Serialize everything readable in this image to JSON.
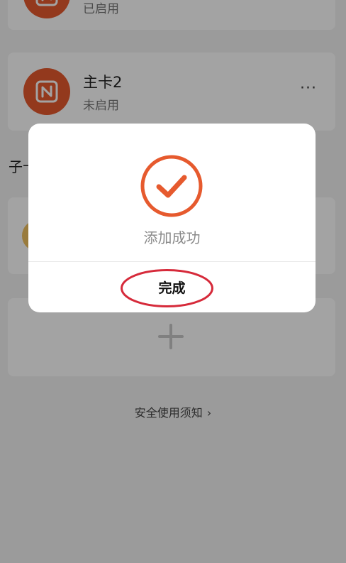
{
  "cards": {
    "top": {
      "status": "已启用"
    },
    "main": {
      "name": "主卡2",
      "status": "未启用",
      "more": "···"
    }
  },
  "section": {
    "label": "子卡"
  },
  "safety": {
    "label": "安全使用须知",
    "chevron": "›"
  },
  "dialog": {
    "message": "添加成功",
    "done_label": "完成"
  },
  "colors": {
    "accent": "#E65A2E",
    "annotation": "#D62A3A"
  },
  "icons": {
    "nfc": "nfc-icon",
    "success": "check-circle-icon",
    "plus": "plus-icon",
    "more": "more-icon"
  }
}
